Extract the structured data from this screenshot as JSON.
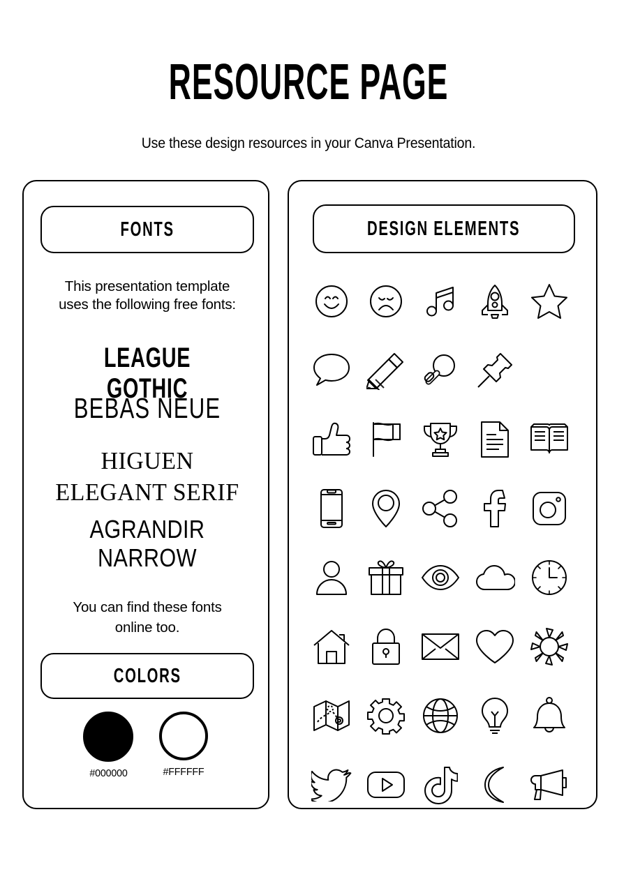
{
  "header": {
    "title": "RESOURCE PAGE",
    "subtitle": "Use these design resources in your Canva Presentation."
  },
  "fonts_panel": {
    "header_label": "FONTS",
    "intro_line1": "This presentation template",
    "intro_line2": "uses the following free fonts:",
    "samples": [
      {
        "name": "LEAGUE GOTHIC"
      },
      {
        "name": "BEBAS NEUE"
      },
      {
        "name": "HIGUEN",
        "name2": "ELEGANT SERIF"
      },
      {
        "name": "AGRANDIR",
        "name2": "NARROW"
      }
    ],
    "outro_line1": "You can find these fonts",
    "outro_line2": "online too.",
    "colors_header_label": "COLORS",
    "swatches": [
      {
        "hex": "#000000",
        "label": "#000000"
      },
      {
        "hex": "#FFFFFF",
        "label": "#FFFFFF"
      }
    ]
  },
  "elements_panel": {
    "header_label": "DESIGN ELEMENTS",
    "icon_rows": [
      [
        "smiley-face-icon",
        "sad-face-icon",
        "music-note-icon",
        "rocket-icon",
        "star-icon"
      ],
      [
        "speech-bubble-icon",
        "pencil-icon",
        "magnifier-icon",
        "pushpin-icon"
      ],
      [
        "thumbs-up-icon",
        "flag-icon",
        "trophy-icon",
        "document-icon",
        "open-book-icon"
      ],
      [
        "smartphone-icon",
        "location-pin-icon",
        "share-icon",
        "facebook-icon",
        "instagram-icon"
      ],
      [
        "user-icon",
        "gift-icon",
        "eye-icon",
        "cloud-icon",
        "clock-icon"
      ],
      [
        "house-icon",
        "lock-icon",
        "envelope-icon",
        "heart-icon",
        "sun-icon"
      ],
      [
        "map-icon",
        "gear-icon",
        "globe-icon",
        "lightbulb-icon",
        "bell-icon"
      ],
      [
        "twitter-icon",
        "youtube-icon",
        "tiktok-icon",
        "moon-icon",
        "megaphone-icon"
      ]
    ]
  },
  "colors": {
    "stroke": "#000000",
    "background": "#FFFFFF"
  }
}
